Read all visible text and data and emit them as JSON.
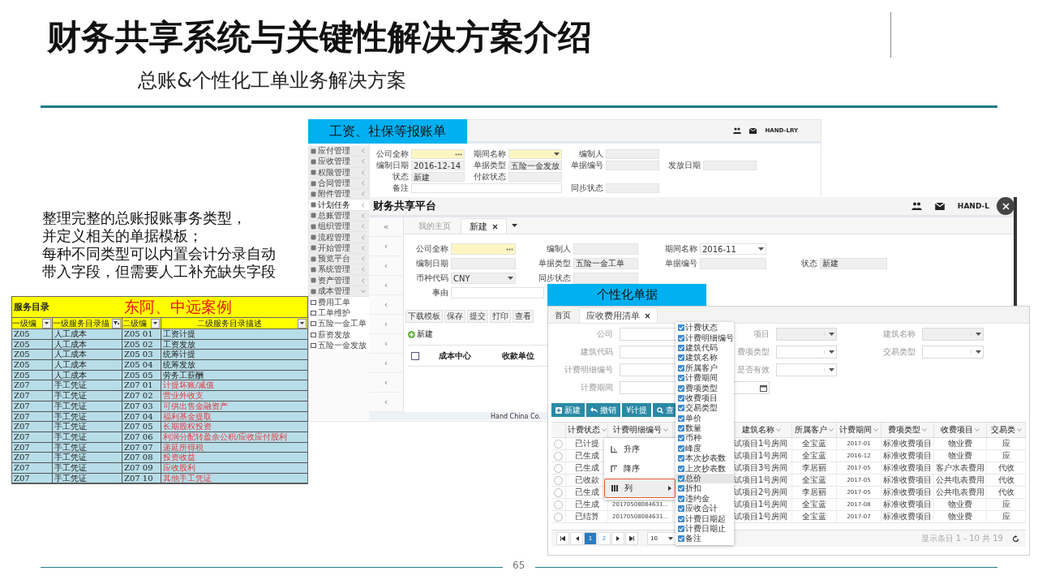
{
  "title": "财务共享系统与关键性解决方案介绍",
  "subtitle": "总账&个性化工单业务解决方案",
  "intro": [
    "整理完整的总账报账事务类型，",
    "并定义相关的单据模板；",
    "每种不同类型可以内置会计分录自动",
    "带入字段，但需要人工补充缺失字段"
  ],
  "case_table": {
    "title": "服务目录",
    "case_label": "东阿、中远案例",
    "columns": [
      {
        "label": "一级编",
        "filtered": false
      },
      {
        "label": "一级服务目录描",
        "filtered": true
      },
      {
        "label": "二级编",
        "filtered": false
      },
      {
        "label": "二级服务目录描述",
        "filtered": false
      }
    ],
    "rows": [
      {
        "cells": [
          "Z05",
          "人工成本",
          "Z05 01",
          "工资计提"
        ],
        "highlighted": false
      },
      {
        "cells": [
          "Z05",
          "人工成本",
          "Z05 02",
          "工资发放"
        ],
        "highlighted": false
      },
      {
        "cells": [
          "Z05",
          "人工成本",
          "Z05 03",
          "统筹计提"
        ],
        "highlighted": false
      },
      {
        "cells": [
          "Z05",
          "人工成本",
          "Z05 04",
          "统筹发放"
        ],
        "highlighted": false
      },
      {
        "cells": [
          "Z05",
          "人工成本",
          "Z05 05",
          "劳务工薪酬"
        ],
        "highlighted": false
      },
      {
        "cells": [
          "Z07",
          "手工凭证",
          "Z07 01",
          "计提坏账/减值"
        ],
        "highlighted": true
      },
      {
        "cells": [
          "Z07",
          "手工凭证",
          "Z07 02",
          "营业外收支"
        ],
        "highlighted": true
      },
      {
        "cells": [
          "Z07",
          "手工凭证",
          "Z07 03",
          "可供出售金融资产"
        ],
        "highlighted": true
      },
      {
        "cells": [
          "Z07",
          "手工凭证",
          "Z07 04",
          "福利基金提取"
        ],
        "highlighted": true
      },
      {
        "cells": [
          "Z07",
          "手工凭证",
          "Z07 05",
          "长期股权投资"
        ],
        "highlighted": true
      },
      {
        "cells": [
          "Z07",
          "手工凭证",
          "Z07 06",
          "利润分配转盈余公积/应收应付股利"
        ],
        "highlighted": true
      },
      {
        "cells": [
          "Z07",
          "手工凭证",
          "Z07 07",
          "递延所得税"
        ],
        "highlighted": true
      },
      {
        "cells": [
          "Z07",
          "手工凭证",
          "Z07 08",
          "投资收益"
        ],
        "highlighted": true
      },
      {
        "cells": [
          "Z07",
          "手工凭证",
          "Z07 09",
          "应收股利"
        ],
        "highlighted": true
      },
      {
        "cells": [
          "Z07",
          "手工凭证",
          "Z07 10",
          "其他手工凭证"
        ],
        "highlighted": true
      }
    ]
  },
  "screen_a": {
    "label": "工资、社保等报账单",
    "user": "HAND-LRY",
    "menu": [
      {
        "label": "应付管理",
        "selected": false,
        "expanded": false
      },
      {
        "label": "应收管理",
        "selected": false,
        "expanded": false
      },
      {
        "label": "权限管理",
        "selected": false,
        "expanded": false
      },
      {
        "label": "合同管理",
        "selected": false,
        "expanded": false
      },
      {
        "label": "附件管理",
        "selected": false,
        "expanded": false
      },
      {
        "label": "计划任务",
        "selected": true,
        "expanded": false
      },
      {
        "label": "总账管理",
        "selected": false,
        "expanded": false
      },
      {
        "label": "组织管理",
        "selected": false,
        "expanded": false
      },
      {
        "label": "流程管理",
        "selected": false,
        "expanded": false
      },
      {
        "label": "开始管理",
        "selected": false,
        "expanded": false
      },
      {
        "label": "预览平台",
        "selected": false,
        "expanded": false
      },
      {
        "label": "系统管理",
        "selected": false,
        "expanded": false
      },
      {
        "label": "资产管理",
        "selected": false,
        "expanded": false
      },
      {
        "label": "成本管理",
        "selected": false,
        "expanded": true,
        "children": [
          {
            "label": "费用工单"
          },
          {
            "label": "工单维护"
          },
          {
            "label": "五险一金工单"
          },
          {
            "label": "薪资发放"
          },
          {
            "label": "五险一金发放"
          }
        ]
      }
    ],
    "form": [
      [
        {
          "label": "公司全称",
          "kind": "lookup",
          "required": true,
          "disabled": false
        },
        {
          "label": "期间名称",
          "kind": "select",
          "required": true,
          "disabled": false
        },
        {
          "label": "编制人",
          "kind": "text",
          "required": false,
          "disabled": true
        }
      ],
      [
        {
          "label": "编制日期",
          "kind": "text",
          "value": "2016-12-14",
          "required": false,
          "disabled": true
        },
        {
          "label": "单据类型",
          "kind": "text",
          "value": "五险一金发放",
          "required": false,
          "disabled": true
        },
        {
          "label": "单据编号",
          "kind": "text",
          "required": false,
          "disabled": true
        },
        {
          "label": "发放日期",
          "kind": "text",
          "required": false,
          "disabled": true
        }
      ],
      [
        {
          "label": "状态",
          "kind": "text",
          "value": "新建",
          "required": false,
          "disabled": true
        },
        {
          "label": "付款状态",
          "kind": "text",
          "required": false,
          "disabled": true
        }
      ],
      [
        {
          "label": "备注",
          "kind": "wide",
          "required": false,
          "disabled": false
        },
        {
          "label": "同步状态",
          "kind": "text",
          "required": false,
          "disabled": true
        }
      ]
    ]
  },
  "screen_b": {
    "title": "财务共享平台",
    "user": "HAND-L",
    "rail": [
      "«",
      "‹",
      "‹",
      "‹",
      "‹",
      "‹",
      "‹",
      "‹",
      "‹",
      "‹"
    ],
    "tabs": [
      {
        "label": "我的主页",
        "selected": false,
        "closable": false
      },
      {
        "label": "新建",
        "selected": true,
        "closable": true
      }
    ],
    "form": [
      [
        {
          "label": "公司全称",
          "kind": "lookup",
          "required": true,
          "disabled": false
        },
        {
          "label": "编制人",
          "kind": "text",
          "required": false,
          "disabled": true
        },
        {
          "label": "期间名称",
          "kind": "select",
          "value": "2016-11",
          "required": false,
          "disabled": false
        }
      ],
      [
        {
          "label": "编制日期",
          "kind": "text",
          "required": false,
          "disabled": true
        },
        {
          "label": "单据类型",
          "kind": "text",
          "value": "五险一金工单",
          "required": false,
          "disabled": true
        },
        {
          "label": "单据编号",
          "kind": "text",
          "required": false,
          "disabled": true
        },
        {
          "label": "状态",
          "kind": "text",
          "value": "新建",
          "required": false,
          "disabled": true
        }
      ],
      [
        {
          "label": "币种代码",
          "kind": "select",
          "value": "CNY",
          "required": false,
          "disabled": true
        },
        {
          "label": "同步状态",
          "kind": "text",
          "required": false,
          "disabled": true
        }
      ],
      [
        {
          "label": "事由",
          "kind": "wide",
          "required": false,
          "disabled": false
        }
      ]
    ],
    "buttons": [
      "下载模板",
      "保存",
      "提交",
      "打印",
      "查看"
    ],
    "add_link": "新建",
    "select_all": false,
    "columns": [
      "成本中心",
      "收款单位"
    ],
    "footer": "Hand China Co."
  },
  "screen_c": {
    "label": "个性化单据",
    "tabs": [
      {
        "label": "首页",
        "selected": false,
        "closable": false
      },
      {
        "label": "应收费用清单",
        "selected": true,
        "closable": true
      }
    ],
    "form": [
      [
        {
          "label": "公司",
          "kind": "select",
          "required": false,
          "disabled": false
        },
        {
          "label": "项目",
          "kind": "select",
          "required": false,
          "disabled": true
        },
        {
          "label": "建筑名称",
          "kind": "select",
          "required": false,
          "disabled": true
        }
      ],
      [
        {
          "label": "建筑代码",
          "kind": "text",
          "required": false,
          "disabled": false
        },
        {
          "label": "费项类型",
          "kind": "select",
          "required": false,
          "disabled": false
        },
        {
          "label": "交易类型",
          "kind": "select",
          "required": false,
          "disabled": false
        }
      ],
      [
        {
          "label": "计费明细编号",
          "kind": "text",
          "required": false,
          "disabled": false
        },
        {
          "label": "是否有效",
          "kind": "select",
          "required": false,
          "disabled": false
        }
      ],
      [
        {
          "label": "计费期间",
          "kind": "date",
          "required": false,
          "disabled": false
        }
      ]
    ],
    "buttons": [
      {
        "label": "新建",
        "kind": "add"
      },
      {
        "label": "撤销",
        "kind": "undo"
      },
      {
        "label": "¥计提",
        "kind": "plain"
      },
      {
        "label": "查",
        "kind": "search"
      }
    ],
    "columns": [
      "计费状态",
      "计费明细编号",
      "建筑名称",
      "所属客户",
      "计费期间",
      "费项类型",
      "收费项目",
      "交易类"
    ],
    "rows": [
      {
        "selected": false,
        "status": "已计提",
        "building": "试项目1号房间",
        "customer": "全宝蓝",
        "period": "2017-01",
        "fee_type": "标准收费项目",
        "charge_item": "物业费",
        "trade_type": "应"
      },
      {
        "selected": false,
        "status": "已生成",
        "building": "试项目1号房间",
        "customer": "全宝蓝",
        "period": "2016-12",
        "fee_type": "标准收费项目",
        "charge_item": "物业费",
        "trade_type": "应"
      },
      {
        "selected": false,
        "status": "已生成",
        "building": "试项目3号房间",
        "customer": "李居丽",
        "period": "2017-05",
        "fee_type": "标准收费项目",
        "charge_item": "客户水表费用",
        "trade_type": "代收"
      },
      {
        "selected": false,
        "status": "已收款",
        "building": "试项目1号房间",
        "customer": "全宝蓝",
        "period": "2017-05",
        "fee_type": "标准收费项目",
        "charge_item": "公共电表费用",
        "trade_type": "代收"
      },
      {
        "selected": false,
        "status": "已生成",
        "building": "试项目2号房间",
        "customer": "李居丽",
        "period": "2017-05",
        "fee_type": "标准收费项目",
        "charge_item": "公共电表费用",
        "trade_type": "代收"
      },
      {
        "selected": false,
        "status": "已生成",
        "detail_no": "20170508084631...",
        "building": "试项目1号房间",
        "customer": "全宝蓝",
        "period": "2017-08",
        "fee_type": "标准收费项目",
        "charge_item": "物业费",
        "trade_type": "应"
      },
      {
        "selected": false,
        "status": "已结算",
        "detail_no": "20170508084631...",
        "building": "试项目1号房间",
        "customer": "全宝蓝",
        "period": "2017-07",
        "fee_type": "标准收费项目",
        "charge_item": "物业费",
        "trade_type": "应"
      }
    ],
    "pager": {
      "pages": [
        {
          "label": "1",
          "selected": true
        },
        {
          "label": "2",
          "selected": false
        }
      ],
      "page_size": "10",
      "summary": "显示条目 1 - 10 共 19"
    },
    "context_menu": [
      {
        "label": "升序",
        "kind": "asc",
        "selected": false
      },
      {
        "label": "降序",
        "kind": "desc",
        "selected": false
      },
      {
        "label": "列",
        "kind": "columns",
        "selected": true
      }
    ],
    "column_chooser": [
      {
        "label": "计费状态",
        "checked": true,
        "selected": false
      },
      {
        "label": "计费明细编号",
        "checked": true,
        "selected": false
      },
      {
        "label": "建筑代码",
        "checked": true,
        "selected": false
      },
      {
        "label": "建筑名称",
        "checked": true,
        "selected": false
      },
      {
        "label": "所属客户",
        "checked": true,
        "selected": false
      },
      {
        "label": "计费期间",
        "checked": true,
        "selected": false
      },
      {
        "label": "费项类型",
        "checked": true,
        "selected": false
      },
      {
        "label": "收费项目",
        "checked": true,
        "selected": false
      },
      {
        "label": "交易类型",
        "checked": true,
        "selected": false
      },
      {
        "label": "单价",
        "checked": true,
        "selected": false
      },
      {
        "label": "数量",
        "checked": true,
        "selected": false
      },
      {
        "label": "币种",
        "checked": true,
        "selected": false
      },
      {
        "label": "峰度",
        "checked": true,
        "selected": false
      },
      {
        "label": "本次抄表数",
        "checked": true,
        "selected": false
      },
      {
        "label": "上次抄表数",
        "checked": true,
        "selected": false
      },
      {
        "label": "总价",
        "checked": true,
        "selected": true
      },
      {
        "label": "折扣",
        "checked": true,
        "selected": false
      },
      {
        "label": "违约金",
        "checked": true,
        "selected": false
      },
      {
        "label": "应收合计",
        "checked": true,
        "selected": false
      },
      {
        "label": "计费日期起",
        "checked": true,
        "selected": false
      },
      {
        "label": "计费日期止",
        "checked": true,
        "selected": false
      },
      {
        "label": "备注",
        "checked": true,
        "selected": false
      }
    ]
  },
  "page_number": "65"
}
